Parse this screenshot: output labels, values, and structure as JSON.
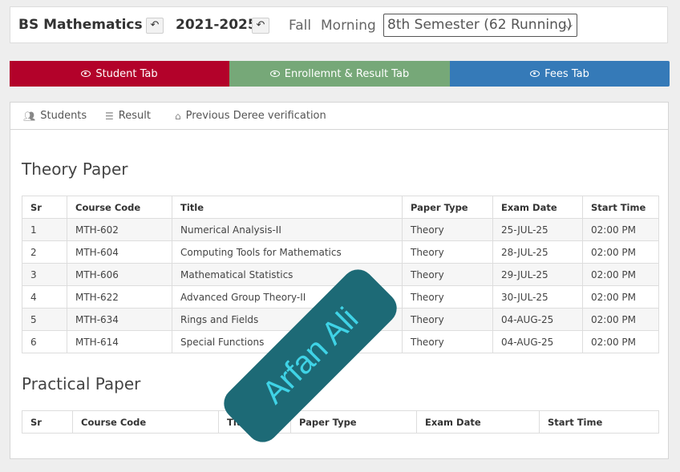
{
  "header": {
    "program": "BS Mathematics",
    "session": "2021-2025",
    "season": "Fall",
    "shift": "Morning",
    "semester_selected": "8th Semester (62 Running)",
    "back_icon": "reply-arrow-icon"
  },
  "main_tabs": [
    {
      "label": "Student Tab",
      "color": "#b3022a",
      "icon": "eye-icon"
    },
    {
      "label": "Enrollemnt & Result Tab",
      "color": "#76a878",
      "icon": "eye-icon"
    },
    {
      "label": "Fees Tab",
      "color": "#357ab8",
      "icon": "eye-icon"
    }
  ],
  "sub_tabs": [
    {
      "label": "Students",
      "icon": "users-icon"
    },
    {
      "label": "Result",
      "icon": "list-icon"
    },
    {
      "label": "Previous Deree verification",
      "icon": "graduation-cap-icon"
    }
  ],
  "theory": {
    "title": "Theory Paper",
    "columns": [
      "Sr",
      "Course Code",
      "Title",
      "Paper Type",
      "Exam Date",
      "Start Time"
    ],
    "rows": [
      [
        "1",
        "MTH-602",
        "Numerical Analysis-II",
        "Theory",
        "25-JUL-25",
        "02:00 PM"
      ],
      [
        "2",
        "MTH-604",
        "Computing Tools for Mathematics",
        "Theory",
        "28-JUL-25",
        "02:00 PM"
      ],
      [
        "3",
        "MTH-606",
        "Mathematical Statistics",
        "Theory",
        "29-JUL-25",
        "02:00 PM"
      ],
      [
        "4",
        "MTH-622",
        "Advanced Group Theory-II",
        "Theory",
        "30-JUL-25",
        "02:00 PM"
      ],
      [
        "5",
        "MTH-634",
        "Rings and Fields",
        "Theory",
        "04-AUG-25",
        "02:00 PM"
      ],
      [
        "6",
        "MTH-614",
        "Special Functions",
        "Theory",
        "04-AUG-25",
        "02:00 PM"
      ]
    ]
  },
  "practical": {
    "title": "Practical Paper",
    "columns": [
      "Sr",
      "Course Code",
      "Title",
      "Paper Type",
      "Exam Date",
      "Start Time"
    ]
  },
  "watermark": {
    "text": "Arfan Ali",
    "color": "#1d6a76",
    "text_color": "#3fd3e6"
  }
}
